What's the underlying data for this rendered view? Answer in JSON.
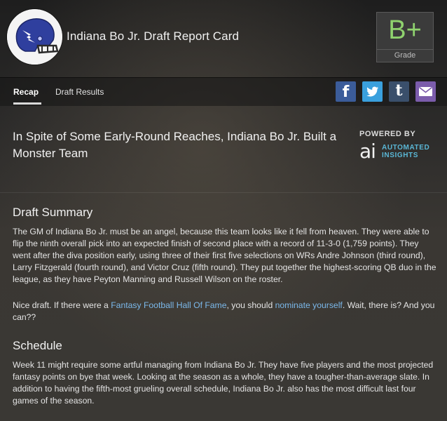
{
  "header": {
    "team_title": "Indiana Bo Jr. Draft Report Card",
    "grade": {
      "value": "B+",
      "label": "Grade"
    }
  },
  "tabs": [
    {
      "label": "Recap",
      "active": true
    },
    {
      "label": "Draft Results",
      "active": false
    }
  ],
  "share": [
    {
      "name": "facebook",
      "glyph": "f",
      "color": "#3b5c9a"
    },
    {
      "name": "twitter",
      "glyph": "twitter-bird-icon",
      "color": "#3aa0dd"
    },
    {
      "name": "tumblr",
      "glyph": "t",
      "color": "#3a4f6b"
    },
    {
      "name": "email",
      "glyph": "envelope-icon",
      "color": "#7b5cab"
    }
  ],
  "headline": "In Spite of Some Early-Round Reaches, Indiana Bo Jr. Built a Monster Team",
  "powered_by": {
    "label": "POWERED BY",
    "logo_mark": "ai",
    "brand_line1": "AUTOMATED",
    "brand_line2": "INSIGHTS"
  },
  "draft_summary": {
    "title": "Draft Summary",
    "paragraph1": "The GM of Indiana Bo Jr. must be an angel, because this team looks like it fell from heaven. They were able to flip the ninth overall pick into an expected finish of second place with a record of 11-3-0 (1,759 points). They went after the diva position early, using three of their first five selections on WRs Andre Johnson (third round), Larry Fitzgerald (fourth round), and Victor Cruz (fifth round). They put together the highest-scoring QB duo in the league, as they have Peyton Manning and Russell Wilson on the roster.",
    "paragraph2_before": "Nice draft. If there were a ",
    "paragraph2_link1": "Fantasy Football Hall Of Fame",
    "paragraph2_mid": ", you should ",
    "paragraph2_link2": "nominate yourself",
    "paragraph2_after": ". Wait, there is? And you can??"
  },
  "schedule": {
    "title": "Schedule",
    "paragraph": "Week 11 might require some artful managing from Indiana Bo Jr. They have five players and the most projected fantasy points on bye that week. Looking at the season as a whole, they have a tougher-than-average slate. In addition to having the fifth-most grueling overall schedule, Indiana Bo Jr. also has the most difficult last four games of the season."
  },
  "colors": {
    "grade": "#8fd26e",
    "link": "#7bb8ea",
    "brand": "#5ab7d6",
    "helmet": "#2f3f9e"
  }
}
